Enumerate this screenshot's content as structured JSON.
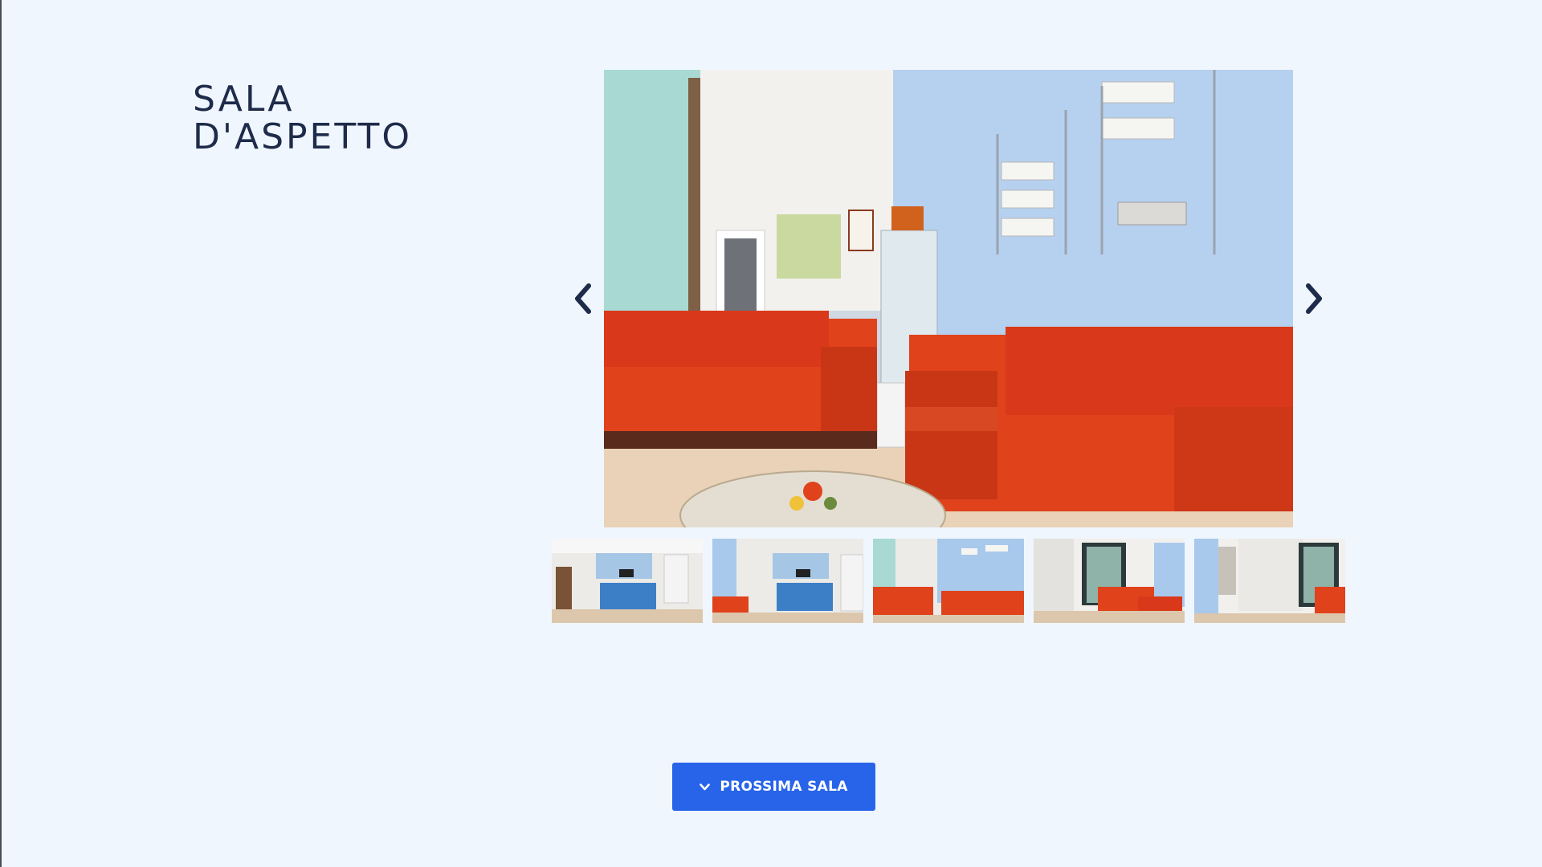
{
  "room": {
    "title_line1": "SALA",
    "title_line2": "D'ASPETTO"
  },
  "carousel": {
    "prev_icon": "chevron-left-icon",
    "next_icon": "chevron-right-icon",
    "main_image_alt": "Sala d'aspetto con divani rossi",
    "thumbnails": [
      {
        "alt": "Reception"
      },
      {
        "alt": "Reception e ingresso"
      },
      {
        "alt": "Sala d'aspetto con divani rossi"
      },
      {
        "alt": "Sala d'aspetto con porta a vetri"
      },
      {
        "alt": "Corridoio con porta a vetri"
      }
    ]
  },
  "next_room": {
    "label": "PROSSIMA SALA",
    "icon": "chevron-down-icon"
  },
  "colors": {
    "background": "#f0f6fe",
    "title": "#1e2b4a",
    "button": "#2764ea",
    "arrow": "#1e2b4a",
    "sofa": "#e0421c"
  }
}
